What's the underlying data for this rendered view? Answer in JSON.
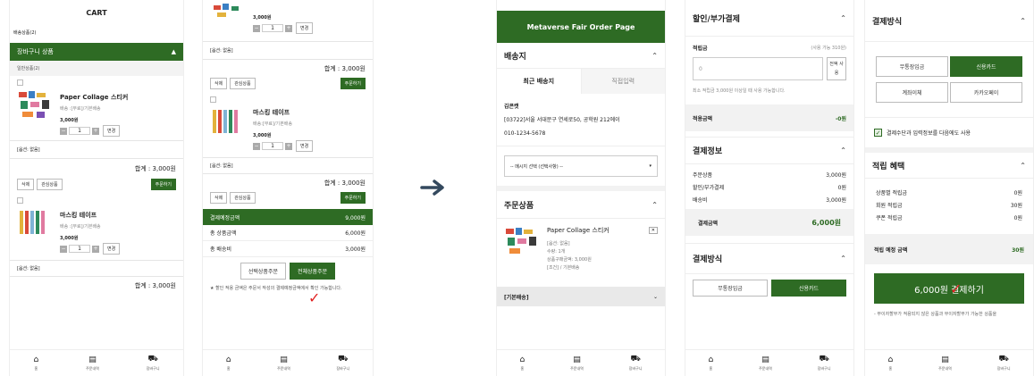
{
  "cart": {
    "title": "CART",
    "delivery_count": "배송상품(2)",
    "section": "장바구니 상품",
    "general": "일반상품(2)",
    "items": [
      {
        "name": "Paper Collage 스티커",
        "delivery": "배송 :[무료]/기본배송",
        "price": "3,000원",
        "qty": "1",
        "change": "변경",
        "option": "[옵션: 없음]",
        "total": "합계 : 3,000원"
      },
      {
        "name": "마스킹 테이프",
        "delivery": "배송 :[무료]/기본배송",
        "price": "3,000원",
        "qty": "1",
        "change": "변경",
        "option": "[옵션: 없음]",
        "total": "합계 : 3,000원"
      }
    ],
    "delete": "삭제",
    "wish": "관심상품",
    "order": "주문하기"
  },
  "cart2": {
    "top_price": "3,000원",
    "qty": "1",
    "change": "변경",
    "option1": "[옵션: 없음]",
    "total1": "합계 : 3,000원",
    "delete": "삭제",
    "wish": "관심상품",
    "order": "주문하기",
    "item2_name": "마스킹 테이프",
    "item2_delivery": "배송:[무료]/기본배송",
    "item2_price": "3,000원",
    "option2": "[옵션: 없음]",
    "total2": "합계 : 3,000원",
    "summary": [
      {
        "label": "결제예정금액",
        "value": "9,000원"
      },
      {
        "label": "총 상품금액",
        "value": "6,000원"
      },
      {
        "label": "총 배송비",
        "value": "3,000원"
      }
    ],
    "order_selected": "선택상품주문",
    "order_all": "전체상품주문",
    "note": "★ 할인 적용 금액은 주문서 작성의 결제예정금액에서 확인 가능합니다."
  },
  "order": {
    "header": "Metaverse Fair Order Page",
    "delivery": "배송지",
    "tab_recent": "최근 배송지",
    "tab_direct": "직접입력",
    "name": "김콘캣",
    "address": "[03722]서울 서대문구 연세로50, 공학원 212에이",
    "phone": "010-1234-5678",
    "message_select": "-- 메시지 선택 (선택사항) --",
    "order_items": "주문상품",
    "product_name": "Paper Collage 스티커",
    "product_option": "[옵션: 없음]",
    "product_qty": "수량: 1개",
    "product_price": "상품구매금액: 3,000원",
    "product_cond": "[조건] / 기본배송",
    "basic_delivery": "[기본배송]"
  },
  "payment": {
    "discount_title": "할인/부가결제",
    "points_label": "적립금",
    "points_avail": "(사용 가능 310원)",
    "points_value": "0",
    "use_all": "전액 사용",
    "points_note": "최소 적립금 3,000원 이상일 때 사용 가능합니다.",
    "applied_label": "적용금액",
    "applied_value": "-0원",
    "info_title": "결제정보",
    "info_rows": [
      {
        "label": "주문상품",
        "value": "3,000원"
      },
      {
        "label": "할인/부가결제",
        "value": "0원"
      },
      {
        "label": "배송비",
        "value": "3,000원"
      }
    ],
    "total_label": "결제금액",
    "total_value": "6,000원",
    "method_title": "결제방식",
    "method_bank": "무통장입금",
    "method_card": "신용카드"
  },
  "final": {
    "method_title": "결제방식",
    "methods": [
      "무통장입금",
      "신용카드",
      "계좌이체",
      "카카오페이"
    ],
    "save_method": "결제수단과 입력정보를 다음에도 사용",
    "benefit_title": "적립 혜택",
    "benefits": [
      {
        "label": "상품별 적립금",
        "value": "0원"
      },
      {
        "label": "회원 적립금",
        "value": "30원"
      },
      {
        "label": "쿠폰 적립금",
        "value": "0원"
      }
    ],
    "expected_label": "적립 예정 금액",
    "expected_value": "30원",
    "pay_button": "6,000원 결제하기",
    "footer_note": "- 무이자할부가 적용되지 않은 상품과 무이자할부가 가능한 상품을"
  },
  "nav": {
    "home": "홈",
    "orders": "주문내역",
    "cart": "장바구니"
  },
  "colors": {
    "accent": "#2e6b24"
  }
}
